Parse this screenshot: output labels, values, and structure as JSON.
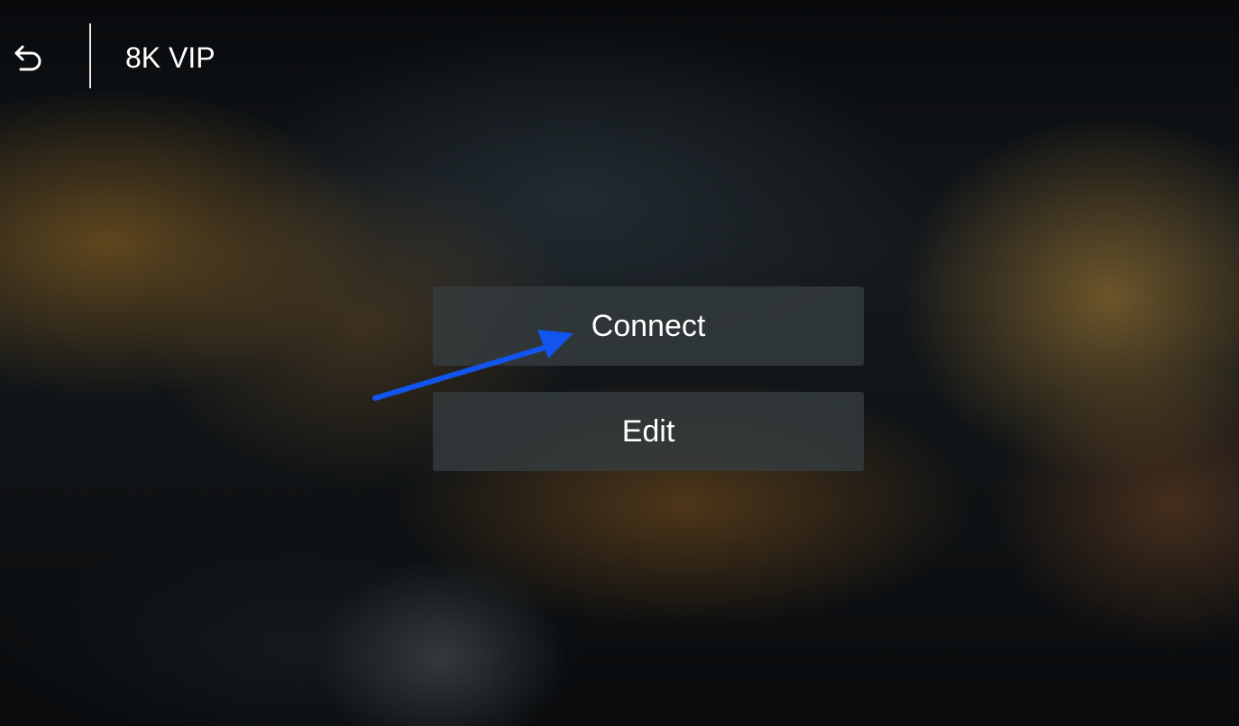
{
  "header": {
    "back_icon": "back-arrow-icon",
    "title": "8K VIP"
  },
  "menu": {
    "items": [
      {
        "label": "Connect",
        "focused": false
      },
      {
        "label": "Edit",
        "focused": false
      }
    ]
  },
  "annotation": {
    "type": "arrow",
    "points_to": "Connect",
    "color": "#1155ee"
  },
  "colors": {
    "text": "#ffffff",
    "button_bg": "#343c3e",
    "divider": "#e8e8e8",
    "annotation_arrow": "#1155ee"
  }
}
